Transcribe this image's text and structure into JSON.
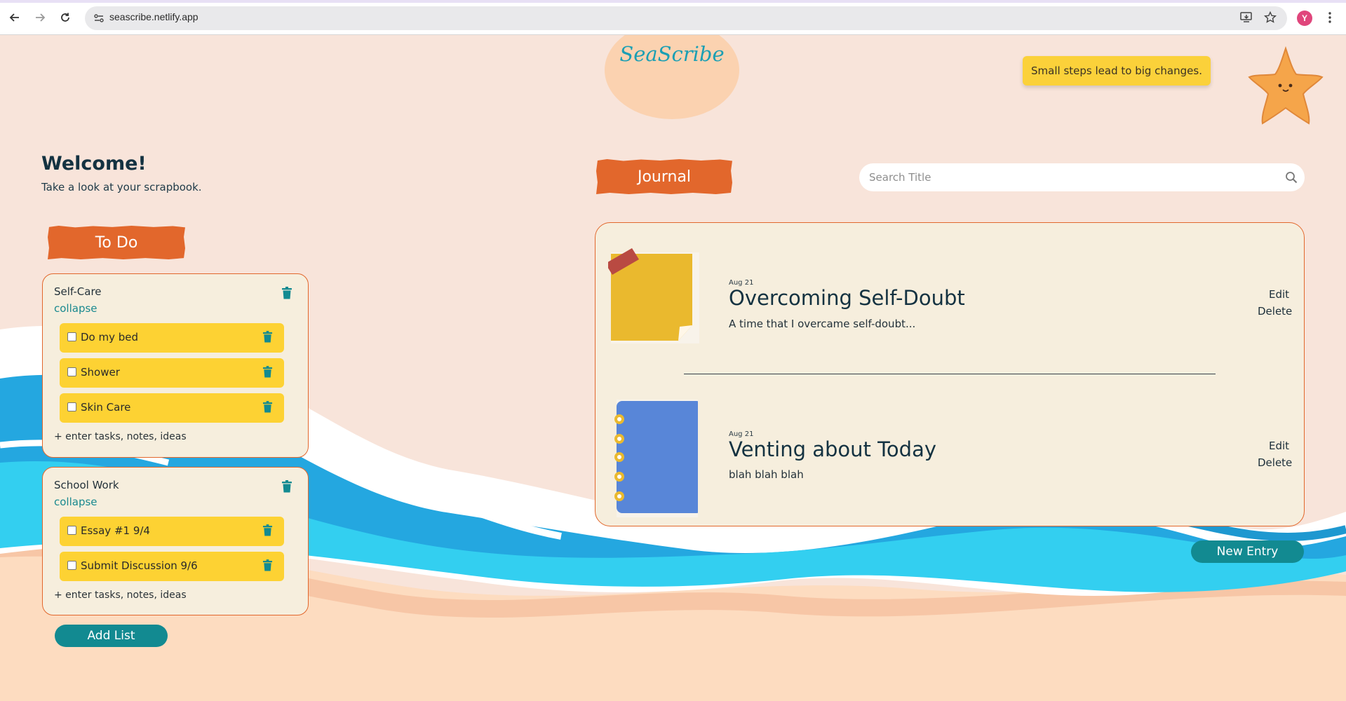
{
  "browser": {
    "url": "seascribe.netlify.app",
    "profile_initial": "Y"
  },
  "app": {
    "logo": "SeaScribe",
    "quote": "Small steps lead to big changes."
  },
  "welcome": {
    "title": "Welcome!",
    "subtitle": "Take a look at your scrapbook."
  },
  "todo": {
    "section_label": "To Do",
    "lists": [
      {
        "title": "Self-Care",
        "collapse_label": "collapse",
        "tasks": [
          {
            "text": "Do my bed",
            "checked": false
          },
          {
            "text": "Shower",
            "checked": false
          },
          {
            "text": "Skin Care",
            "checked": false
          }
        ],
        "add_placeholder": "+ enter tasks, notes, ideas"
      },
      {
        "title": "School Work",
        "collapse_label": "collapse",
        "tasks": [
          {
            "text": "Essay #1 9/4",
            "checked": false
          },
          {
            "text": "Submit Discussion 9/6",
            "checked": false
          }
        ],
        "add_placeholder": "+ enter tasks, notes, ideas"
      }
    ],
    "add_list_label": "Add List"
  },
  "journal": {
    "section_label": "Journal",
    "search_placeholder": "Search Title",
    "entries": [
      {
        "date": "Aug 21",
        "title": "Overcoming Self-Doubt",
        "description": "A time that I overcame self-doubt...",
        "icon": "sticky-note-icon",
        "edit_label": "Edit",
        "delete_label": "Delete"
      },
      {
        "date": "Aug 21",
        "title": "Venting about Today",
        "description": "blah blah blah",
        "icon": "notebook-icon",
        "edit_label": "Edit",
        "delete_label": "Delete"
      }
    ],
    "new_entry_label": "New Entry"
  },
  "colors": {
    "background": "#f8e4da",
    "accent_orange": "#e2672c",
    "teal": "#128a91",
    "task_yellow": "#fdd233",
    "card": "#f6eedd",
    "wave_blue": "#24a7e0",
    "wave_cyan": "#33cff0",
    "sand": "#fddcc0"
  }
}
